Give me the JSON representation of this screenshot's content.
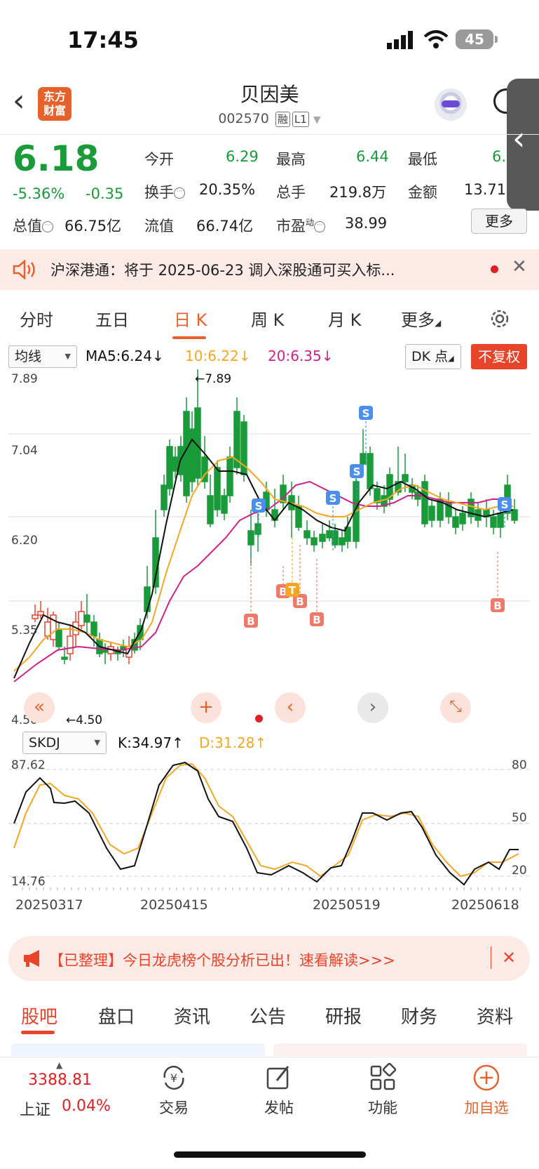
{
  "status_bar": {
    "time": "17:45",
    "battery": "45"
  },
  "header": {
    "logo_line1": "东方",
    "logo_line2": "财富",
    "stock_name": "贝因美",
    "stock_code": "002570",
    "tag_rong": "融",
    "tag_level": "L1"
  },
  "quote": {
    "price": "6.18",
    "pct_change": "-5.36%",
    "abs_change": "-0.35",
    "rows": [
      [
        {
          "label": "今开",
          "value": "6.29"
        },
        {
          "label": "最高",
          "value": "6.44"
        },
        {
          "label": "最低",
          "value": "6."
        }
      ],
      [
        {
          "label": "换手",
          "value": "20.35%"
        },
        {
          "label": "总手",
          "value": "219.8万"
        },
        {
          "label": "金额",
          "value": "13.71"
        }
      ],
      [
        {
          "label": "总值",
          "value": "66.75亿"
        },
        {
          "label": "流值",
          "value": "66.74亿"
        },
        {
          "label": "市盈",
          "sup": "动",
          "value": "38.99"
        }
      ]
    ],
    "more_label": "更多"
  },
  "notice": {
    "text": "沪深港通：将于 2025-06-23 调入深股通可买入标..."
  },
  "chart_tabs": [
    "分时",
    "五日",
    "日 K",
    "周 K",
    "月 K",
    "更多"
  ],
  "chart_controls": {
    "ma_select": "均线",
    "ma5": "MA5:6.24",
    "ma10": "10:6.22",
    "ma20": "20:6.35",
    "dk_select": "DK 点",
    "adjust": "不复权"
  },
  "kline_axis": {
    "y_labels": [
      "7.89",
      "7.04",
      "6.20",
      "5.35",
      "4.50"
    ],
    "max_label": "←7.89",
    "min_label": "←4.50"
  },
  "signals": {
    "buy": "B",
    "sell": "S",
    "t": "T"
  },
  "indicator": {
    "select": "SKDJ",
    "k": "K:34.97",
    "d": "D:31.28",
    "y_left": [
      "87.62",
      "14.76"
    ],
    "y_right": [
      "80",
      "50",
      "20"
    ]
  },
  "dates": [
    "20250317",
    "20250415",
    "20250519",
    "20250618"
  ],
  "promo": {
    "text": "【已整理】今日龙虎榜个股分析已出！速看解读>>>"
  },
  "bottom_tabs": [
    "股吧",
    "盘口",
    "资讯",
    "公告",
    "研报",
    "财务",
    "资料"
  ],
  "footer": {
    "index_value": "3388.81",
    "index_name": "上证",
    "index_pct": "0.04%",
    "nav": [
      "交易",
      "发帖",
      "功能",
      "加自选"
    ]
  },
  "colors": {
    "up": "#e8442a",
    "down": "#1a9b3a",
    "accent": "#e8612a",
    "ma5": "#111111",
    "ma10": "#f5a623",
    "ma20": "#d0208a"
  }
}
